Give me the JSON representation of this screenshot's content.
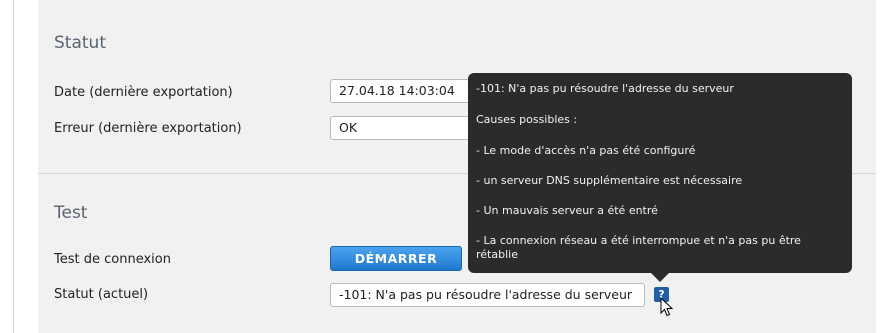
{
  "status_section": {
    "title": "Statut",
    "rows": [
      {
        "label": "Date (dernière exportation)",
        "value": "27.04.18 14:03:04"
      },
      {
        "label": "Erreur (dernière exportation)",
        "value": "OK"
      }
    ]
  },
  "test_section": {
    "title": "Test",
    "connection_test_label": "Test de connexion",
    "start_button_label": "DÉMARRER",
    "current_status_label": "Statut (actuel)",
    "current_status_value": "-101: N'a pas pu résoudre l'adresse du serveur"
  },
  "help": {
    "icon_glyph": "?",
    "icon": "question-mark-icon"
  },
  "tooltip": {
    "lines": [
      "-101: N'a pas pu résoudre l'adresse du serveur",
      "Causes possibles :",
      "- Le mode d'accès n'a pas été configuré",
      "- un serveur DNS supplémentaire est nécessaire",
      "- Un mauvais serveur a été entré",
      "- La connexion réseau a été interrompue et n'a pas pu être rétablie"
    ]
  },
  "colors": {
    "panel_bg": "#f1f1f1",
    "button_blue": "#1f78cf",
    "tooltip_bg": "#2b2b2b",
    "help_icon_bg": "#1f5fa8"
  }
}
